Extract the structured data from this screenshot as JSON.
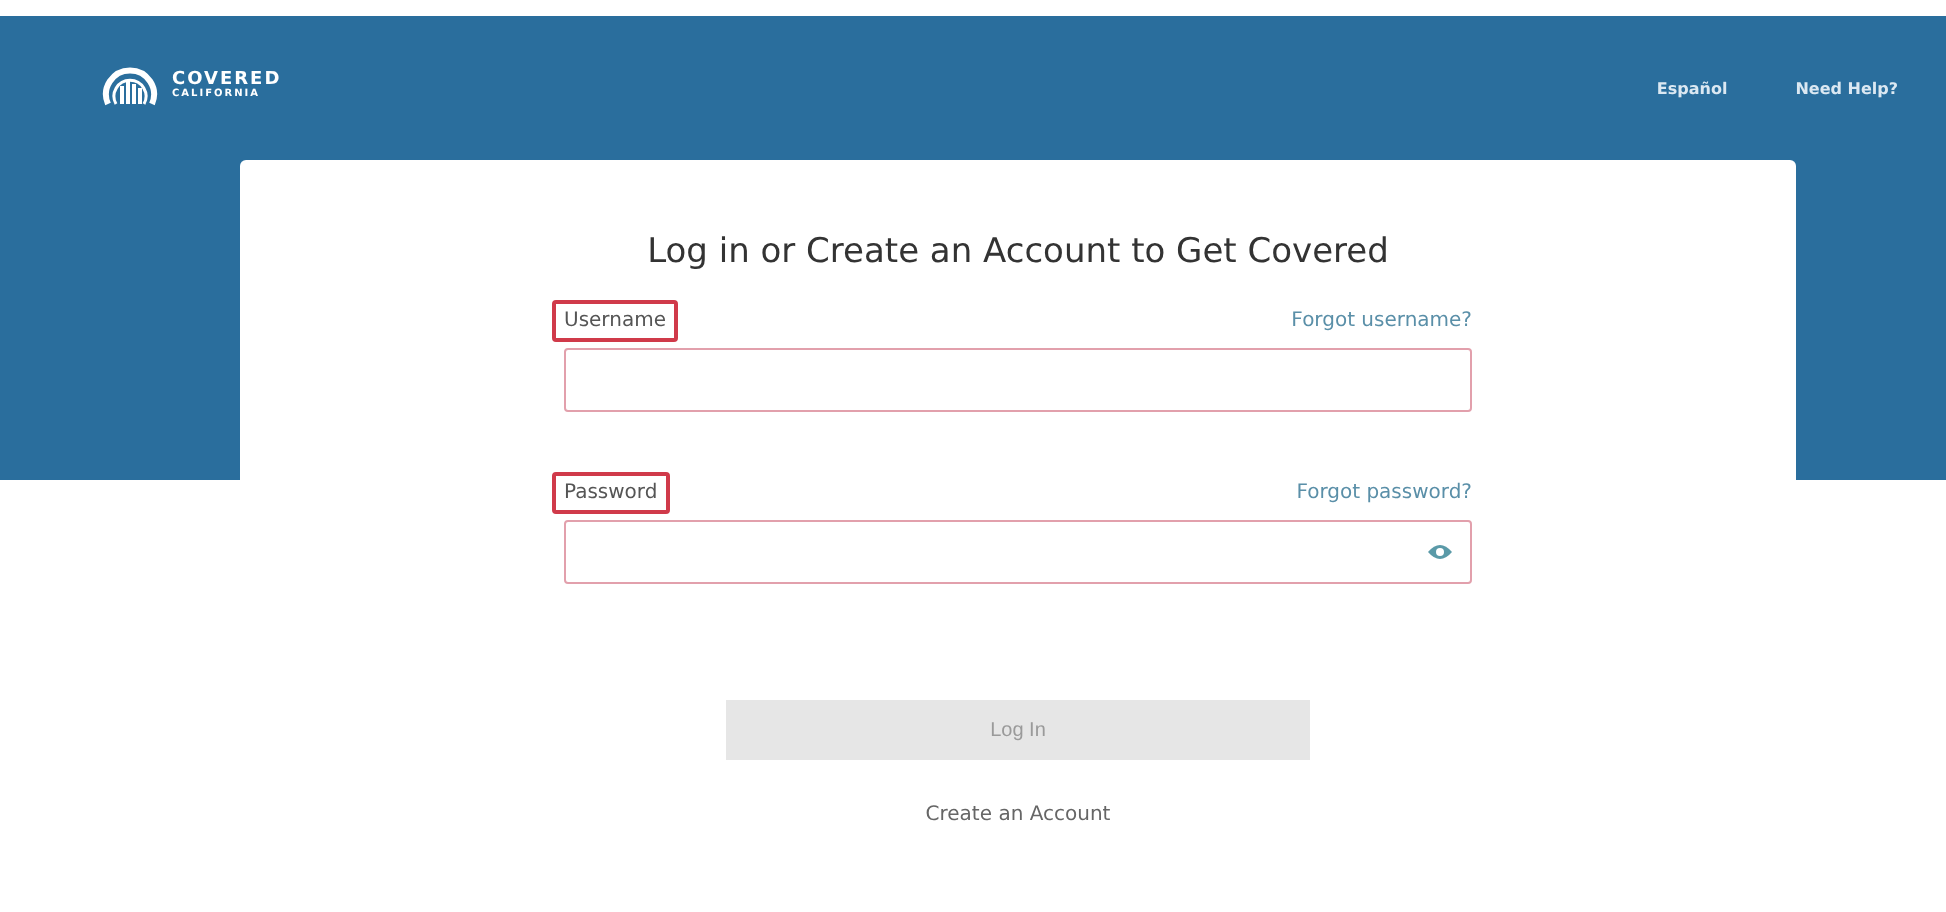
{
  "header": {
    "logo": {
      "line1": "COVERED",
      "line2": "CALIFORNIA"
    },
    "links": [
      "Español",
      "Need Help?"
    ]
  },
  "card": {
    "title": "Log in or Create an Account to Get Covered",
    "fields": [
      {
        "label": "Username",
        "highlighted": true,
        "link": "Forgot username?",
        "kind": "text"
      },
      {
        "label": "Password",
        "highlighted": true,
        "link": "Forgot password?",
        "kind": "password"
      }
    ],
    "submit": {
      "label": "Log In",
      "disabled": true
    },
    "create_link": "Create an Account"
  }
}
